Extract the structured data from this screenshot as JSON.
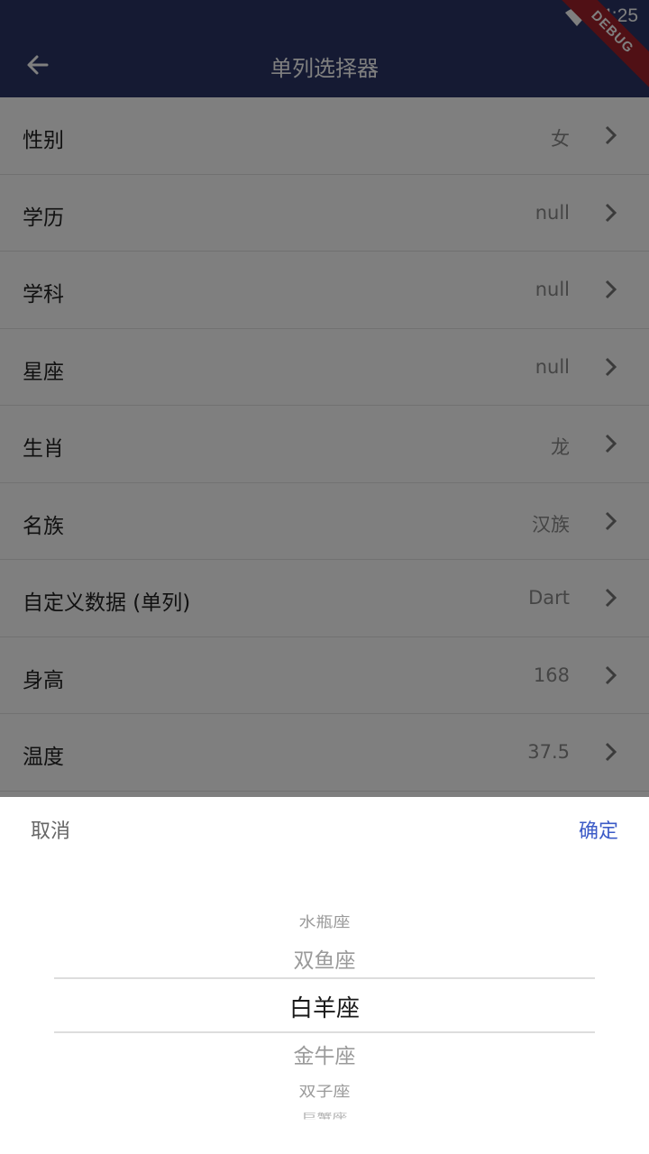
{
  "theme": {
    "primary": "#2a3567",
    "accent": "#3c5bc7"
  },
  "status_bar": {
    "time": "4:25",
    "debug_label": "DEBUG"
  },
  "app_bar": {
    "title": "单列选择器",
    "back_icon": "arrow-left-icon"
  },
  "list": [
    {
      "label": "性别",
      "value": "女"
    },
    {
      "label": "学历",
      "value": "null"
    },
    {
      "label": "学科",
      "value": "null"
    },
    {
      "label": "星座",
      "value": "null"
    },
    {
      "label": "生肖",
      "value": "龙"
    },
    {
      "label": "名族",
      "value": "汉族"
    },
    {
      "label": "自定义数据 (单列)",
      "value": "Dart"
    },
    {
      "label": "身高",
      "value": "168"
    },
    {
      "label": "温度",
      "value": "37.5"
    }
  ],
  "picker": {
    "cancel_label": "取消",
    "confirm_label": "确定",
    "items": [
      "水瓶座",
      "双鱼座",
      "白羊座",
      "金牛座",
      "双子座",
      "巨蟹座"
    ],
    "selected": "白羊座"
  }
}
